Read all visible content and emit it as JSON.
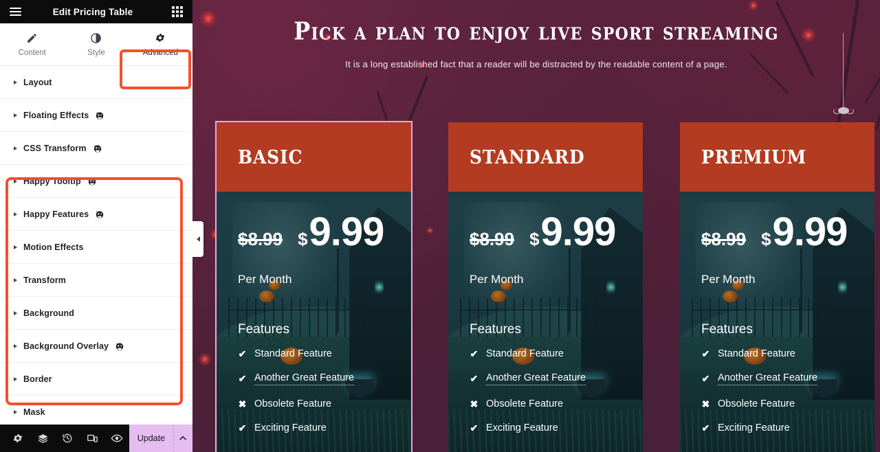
{
  "sidebar": {
    "title": "Edit Pricing Table",
    "menu_icon": "hamburger-icon",
    "apps_icon": "grid-apps-icon",
    "tabs": [
      {
        "label": "Content",
        "icon": "pencil-icon",
        "active": false
      },
      {
        "label": "Style",
        "icon": "contrast-icon",
        "active": false
      },
      {
        "label": "Advanced",
        "icon": "gear-icon",
        "active": true
      }
    ],
    "panels": [
      {
        "label": "Layout",
        "badge": false
      },
      {
        "label": "Floating Effects",
        "badge": true
      },
      {
        "label": "CSS Transform",
        "badge": true
      },
      {
        "label": "Happy Tooltip",
        "badge": true
      },
      {
        "label": "Happy Features",
        "badge": true
      },
      {
        "label": "Motion Effects",
        "badge": false
      },
      {
        "label": "Transform",
        "badge": false
      },
      {
        "label": "Background",
        "badge": false
      },
      {
        "label": "Background Overlay",
        "badge": true
      },
      {
        "label": "Border",
        "badge": false
      },
      {
        "label": "Mask",
        "badge": false
      }
    ],
    "footer": {
      "icons": [
        "gear-icon",
        "layers-icon",
        "history-icon",
        "responsive-icon",
        "preview-eye-icon"
      ],
      "update_label": "Update",
      "arrow_icon": "chevron-up-icon"
    },
    "collapse_icon": "chevron-left-icon"
  },
  "highlights": {
    "accent": "#f4502a",
    "tab_box": "Advanced",
    "panel_box_from": "Happy Tooltip",
    "panel_box_to": "Border"
  },
  "canvas": {
    "hero_title": "Pick a plan to enjoy live sport streaming",
    "hero_subtitle": "It is a long established fact that a reader will be distracted by the readable content of a page.",
    "colors": {
      "page_bg": "#51223c",
      "card_header": "#b33b21",
      "card_body": "#17343c",
      "selection": "#e8a9e0"
    },
    "cards": [
      {
        "title": "BASIC",
        "price_old": "$8.99",
        "currency": "$",
        "price": "9.99",
        "period": "Per Month",
        "features_heading": "Features",
        "selected": true,
        "features": [
          {
            "icon": "check-icon",
            "label": "Standard Feature",
            "tooltip": false
          },
          {
            "icon": "check-icon",
            "label": "Another Great Feature",
            "tooltip": true
          },
          {
            "icon": "cross-icon",
            "label": "Obsolete Feature",
            "tooltip": false
          },
          {
            "icon": "check-icon",
            "label": "Exciting Feature",
            "tooltip": false
          }
        ]
      },
      {
        "title": "STANDARD",
        "price_old": "$8.99",
        "currency": "$",
        "price": "9.99",
        "period": "Per Month",
        "features_heading": "Features",
        "selected": false,
        "features": [
          {
            "icon": "check-icon",
            "label": "Standard Feature",
            "tooltip": false
          },
          {
            "icon": "check-icon",
            "label": "Another Great Feature",
            "tooltip": true
          },
          {
            "icon": "cross-icon",
            "label": "Obsolete Feature",
            "tooltip": false
          },
          {
            "icon": "check-icon",
            "label": "Exciting Feature",
            "tooltip": false
          }
        ]
      },
      {
        "title": "PREMIUM",
        "price_old": "$8.99",
        "currency": "$",
        "price": "9.99",
        "period": "Per Month",
        "features_heading": "Features",
        "selected": false,
        "features": [
          {
            "icon": "check-icon",
            "label": "Standard Feature",
            "tooltip": false
          },
          {
            "icon": "check-icon",
            "label": "Another Great Feature",
            "tooltip": true
          },
          {
            "icon": "cross-icon",
            "label": "Obsolete Feature",
            "tooltip": false
          },
          {
            "icon": "check-icon",
            "label": "Exciting Feature",
            "tooltip": false
          }
        ]
      }
    ]
  }
}
